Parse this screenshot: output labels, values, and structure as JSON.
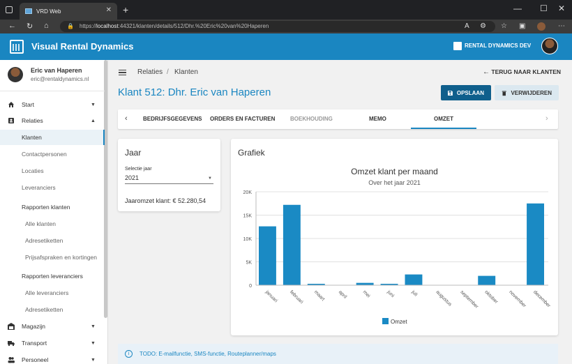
{
  "browser": {
    "tab_title": "VRD Web",
    "url_prefix": "https://",
    "url_host": "localhost",
    "url_rest": ":44321/klanten/details/512/Dhr.%20Eric%20van%20Haperen"
  },
  "app": {
    "title": "Visual Rental Dynamics",
    "environment": "RENTAL DYNAMICS DEV",
    "brand_color": "#1a86c1"
  },
  "user": {
    "name": "Eric van Haperen",
    "email": "eric@rentaldynamics.nl"
  },
  "sidebar": {
    "items": [
      {
        "label": "Start",
        "icon": "home-icon"
      },
      {
        "label": "Relaties",
        "icon": "contact-card-icon"
      },
      {
        "label": "Klanten"
      },
      {
        "label": "Contactpersonen"
      },
      {
        "label": "Locaties"
      },
      {
        "label": "Leveranciers"
      },
      {
        "label": "Rapporten klanten"
      },
      {
        "label": "Alle klanten"
      },
      {
        "label": "Adresetiketten"
      },
      {
        "label": "Prijsafspraken en kortingen"
      },
      {
        "label": "Rapporten leveranciers"
      },
      {
        "label": "Alle leveranciers"
      },
      {
        "label": "Adresetiketten"
      },
      {
        "label": "Magazijn",
        "icon": "warehouse-icon"
      },
      {
        "label": "Transport",
        "icon": "truck-icon"
      },
      {
        "label": "Personeel",
        "icon": "people-icon"
      }
    ]
  },
  "breadcrumb": {
    "level1": "Relaties",
    "separator": "/",
    "level2": "Klanten"
  },
  "back_link": "TERUG NAAR KLANTEN",
  "page_title": "Klant 512: Dhr. Eric van Haperen",
  "buttons": {
    "save": "OPSLAAN",
    "delete": "VERWIJDEREN"
  },
  "tabs": [
    {
      "label": "BEDRIJFSGEGEVENS"
    },
    {
      "label": "ORDERS EN FACTUREN"
    },
    {
      "label": "BOEKHOUDING"
    },
    {
      "label": "MEMO"
    },
    {
      "label": "OMZET"
    }
  ],
  "year_card": {
    "title": "Jaar",
    "select_label": "Selectie jaar",
    "select_value": "2021",
    "total": "Jaaromzet klant: € 52.280,54"
  },
  "chart_card": {
    "title": "Grafiek"
  },
  "chart_data": {
    "type": "bar",
    "title": "Omzet klant per maand",
    "subtitle": "Over het jaar 2021",
    "categories": [
      "januari",
      "februari",
      "maart",
      "april",
      "mei",
      "juni",
      "juli",
      "augustus",
      "september",
      "oktober",
      "november",
      "december"
    ],
    "series": [
      {
        "name": "Omzet",
        "values": [
          12600,
          17200,
          300,
          0,
          500,
          300,
          2300,
          0,
          0,
          2000,
          0,
          17500
        ],
        "color": "#1a8ac4"
      }
    ],
    "ylim": [
      0,
      20000
    ],
    "yticks": [
      "0",
      "5K",
      "10K",
      "15K",
      "20K"
    ],
    "legend": "bottom",
    "grid": true
  },
  "info_bar": {
    "text": "TODO: E-mailfunctie, SMS-functie, Routeplanner/maps"
  }
}
